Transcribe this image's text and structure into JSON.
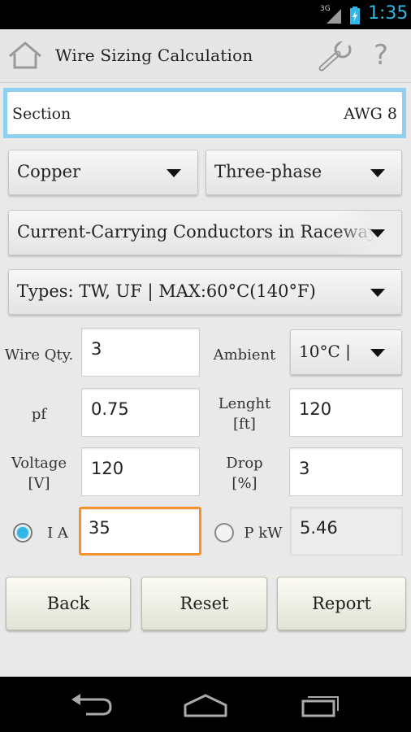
{
  "status": {
    "network": "3G",
    "time": "1:35"
  },
  "header": {
    "title": "Wire Sizing Calculation"
  },
  "section": {
    "label": "Section",
    "value": "AWG 8"
  },
  "spinners": {
    "material": "Copper",
    "phase": "Three-phase",
    "conductors": "Current-Carrying Conductors in Raceway",
    "types": "Types: TW, UF | MAX:60°C(140°F)",
    "ambient": "10°C |"
  },
  "fields": {
    "wire_qty_label": "Wire Qty.",
    "wire_qty_value": "3",
    "ambient_label": "Ambient",
    "pf_label": "pf",
    "pf_value": "0.75",
    "length_label_1": "Lenght",
    "length_label_2": "[ft]",
    "length_value": "120",
    "voltage_label_1": "Voltage",
    "voltage_label_2": "[V]",
    "voltage_value": "120",
    "drop_label_1": "Drop",
    "drop_label_2": "[%]",
    "drop_value": "3",
    "current_label": "I A",
    "current_value": "35",
    "power_label": "P kW",
    "power_value": "5.46"
  },
  "buttons": {
    "back": "Back",
    "reset": "Reset",
    "report": "Report"
  },
  "colors": {
    "accent": "#33b5e5",
    "focus": "#f5922c",
    "section_highlight": "#8fd0ef"
  }
}
